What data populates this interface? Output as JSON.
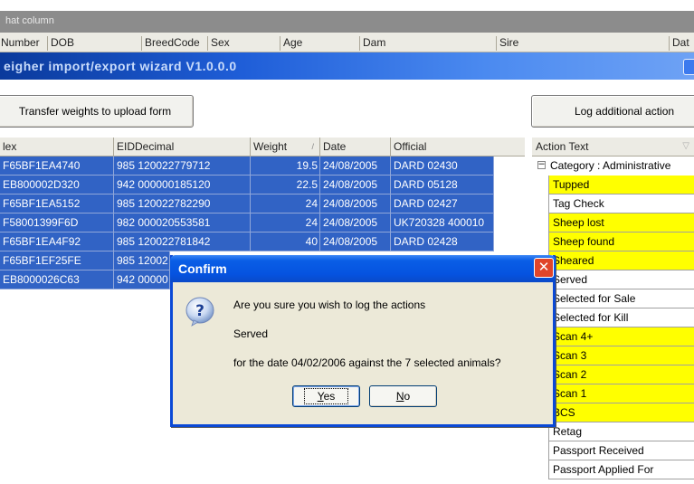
{
  "background_grid": {
    "group_text": "hat column",
    "headers": [
      "Number",
      "DOB",
      "BreedCode",
      "Sex",
      "Age",
      "Dam",
      "Sire",
      "Dat"
    ]
  },
  "wizard": {
    "title": "eigher import/export wizard V1.0.0.0",
    "transfer_button": "Transfer weights to upload form",
    "log_button": "Log additional action"
  },
  "grid": {
    "columns": [
      "lex",
      "EIDDecimal",
      "Weight",
      "Date",
      "Official"
    ],
    "sort_indicator": "/",
    "rows": [
      [
        "F65BF1EA4740",
        "985 120022779712",
        "19.5",
        "24/08/2005",
        "DARD 02430"
      ],
      [
        "EB800002D320",
        "942 000000185120",
        "22.5",
        "24/08/2005",
        "DARD 05128"
      ],
      [
        "F65BF1EA5152",
        "985 120022782290",
        "24",
        "24/08/2005",
        "DARD 02427"
      ],
      [
        "F58001399F6D",
        "982 000020553581",
        "24",
        "24/08/2005",
        "UK720328 400010"
      ],
      [
        "F65BF1EA4F92",
        "985 120022781842",
        "40",
        "24/08/2005",
        "DARD 02428"
      ],
      [
        "F65BF1EF25FE",
        "985 12002",
        "",
        "",
        ""
      ],
      [
        "EB8000026C63",
        "942 00000",
        "",
        "",
        ""
      ]
    ]
  },
  "actions": {
    "header": "Action Text",
    "filter_icon": "▽",
    "category": "Category : Administrative",
    "items": [
      {
        "label": "Tupped",
        "highlight": true
      },
      {
        "label": "Tag Check",
        "highlight": false
      },
      {
        "label": "Sheep lost",
        "highlight": true
      },
      {
        "label": "Sheep found",
        "highlight": true
      },
      {
        "label": "Sheared",
        "highlight": true
      },
      {
        "label": "Served",
        "highlight": false
      },
      {
        "label": "Selected for Sale",
        "highlight": false
      },
      {
        "label": "Selected for Kill",
        "highlight": false
      },
      {
        "label": "Scan 4+",
        "highlight": true
      },
      {
        "label": "Scan 3",
        "highlight": true
      },
      {
        "label": "Scan 2",
        "highlight": true
      },
      {
        "label": "Scan 1",
        "highlight": true
      },
      {
        "label": "BCS",
        "highlight": true
      },
      {
        "label": "Retag",
        "highlight": false
      },
      {
        "label": "Passport Received",
        "highlight": false
      },
      {
        "label": "Passport Applied For",
        "highlight": false
      }
    ]
  },
  "dialog": {
    "title": "Confirm",
    "line1": "Are you sure you wish to log the actions",
    "line2": "Served",
    "line3": "for the date 04/02/2006 against the 7 selected animals?",
    "yes_accel": "Y",
    "yes_rest": "es",
    "no_accel": "N",
    "no_rest": "o",
    "close_glyph": "✕",
    "icon": "question-icon"
  }
}
